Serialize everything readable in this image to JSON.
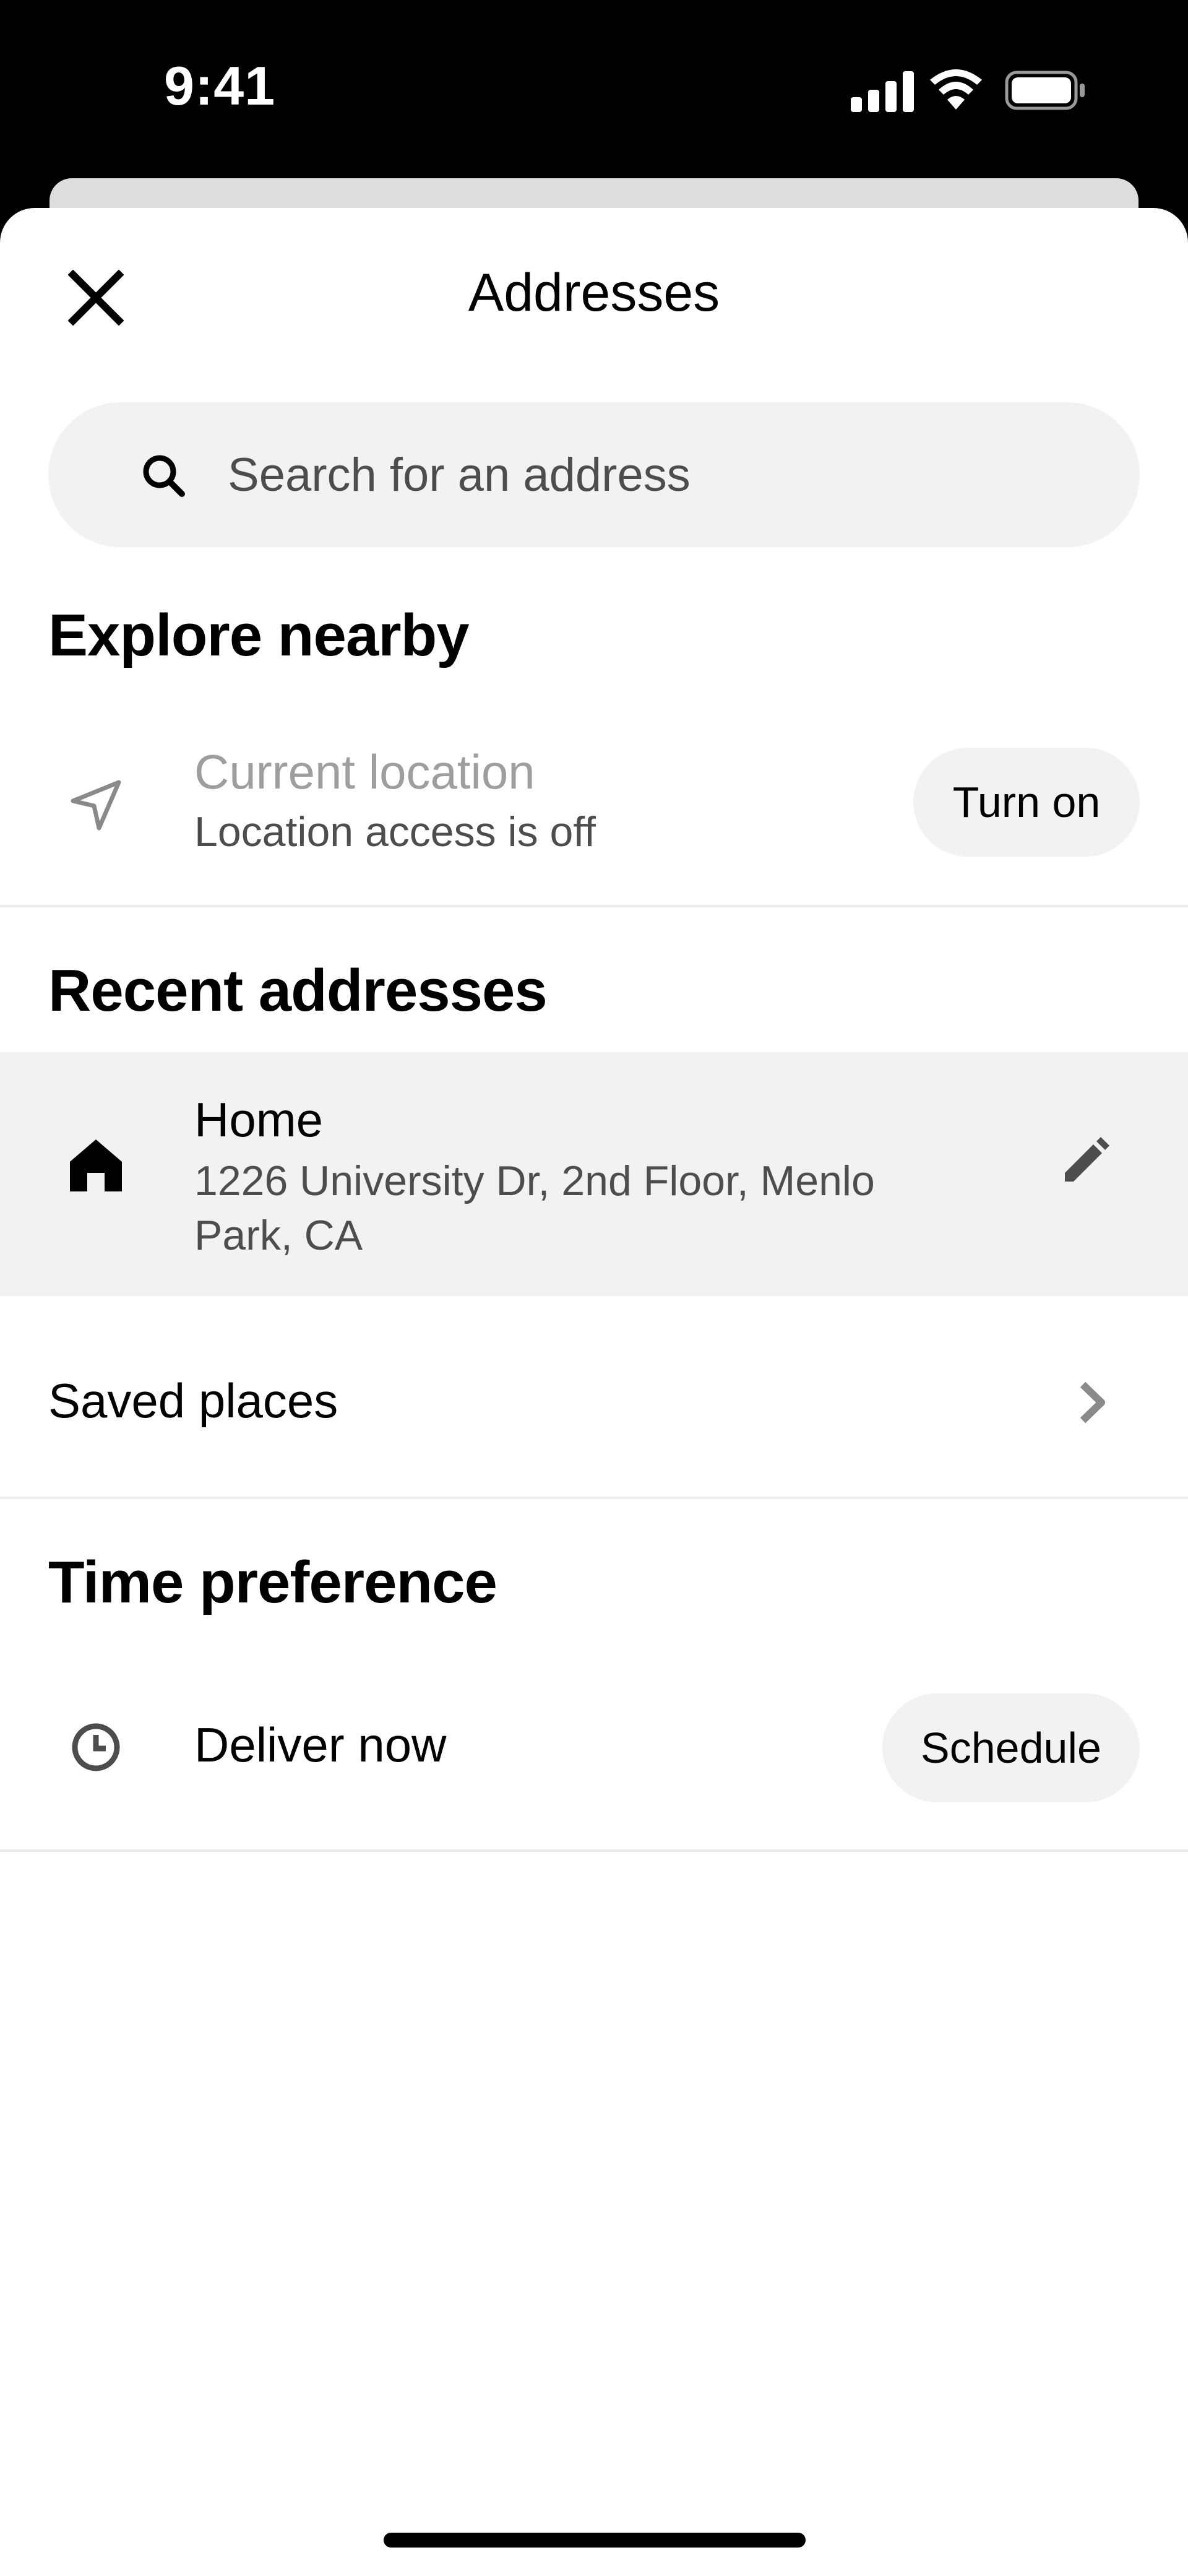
{
  "status_bar": {
    "time": "9:41"
  },
  "header": {
    "title": "Addresses"
  },
  "search": {
    "placeholder": "Search for an address"
  },
  "explore_nearby": {
    "title": "Explore nearby",
    "current_location": {
      "title": "Current location",
      "subtitle": "Location access is off",
      "button_label": "Turn on"
    }
  },
  "recent_addresses": {
    "title": "Recent addresses",
    "items": [
      {
        "label": "Home",
        "address": "1226 University Dr, 2nd Floor, Menlo Park, CA",
        "icon": "home-icon"
      }
    ]
  },
  "saved_places": {
    "label": "Saved places"
  },
  "time_preference": {
    "title": "Time preference",
    "current": "Deliver now",
    "button_label": "Schedule"
  }
}
